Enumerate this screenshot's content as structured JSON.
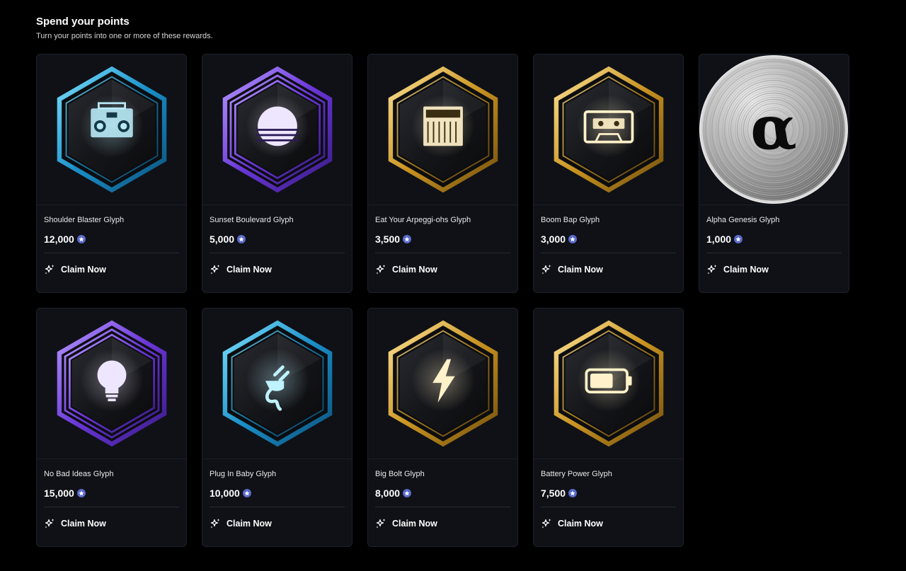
{
  "header": {
    "title": "Spend your points",
    "subtitle": "Turn your points into one or more of these rewards."
  },
  "icons": {
    "points": "star-icon",
    "claim": "sparkles-icon"
  },
  "colors": {
    "background": "#000000",
    "card": "#0f1117",
    "point_badge": "#5a6ac9",
    "blue_frame": "#2fb4e8",
    "purple_frame": "#7a4de0",
    "gold_frame": "#d7a93a"
  },
  "rewards": [
    {
      "name": "Shoulder Blaster Glyph",
      "price": "12,000",
      "claim_label": "Claim Now",
      "frame": "blue",
      "glyph": "boombox"
    },
    {
      "name": "Sunset Boulevard Glyph",
      "price": "5,000",
      "claim_label": "Claim Now",
      "frame": "purple",
      "glyph": "sun"
    },
    {
      "name": "Eat Your Arpeggi-ohs Glyph",
      "price": "3,500",
      "claim_label": "Claim Now",
      "frame": "gold",
      "glyph": "synth"
    },
    {
      "name": "Boom Bap Glyph",
      "price": "3,000",
      "claim_label": "Claim Now",
      "frame": "gold",
      "glyph": "cassette"
    },
    {
      "name": "Alpha Genesis Glyph",
      "price": "1,000",
      "claim_label": "Claim Now",
      "frame": "coin",
      "glyph": "alpha",
      "glyph_text": "α"
    },
    {
      "name": "No Bad Ideas Glyph",
      "price": "15,000",
      "claim_label": "Claim Now",
      "frame": "purple",
      "glyph": "lightbulb"
    },
    {
      "name": "Plug In Baby Glyph",
      "price": "10,000",
      "claim_label": "Claim Now",
      "frame": "blue",
      "glyph": "plug"
    },
    {
      "name": "Big Bolt Glyph",
      "price": "8,000",
      "claim_label": "Claim Now",
      "frame": "gold",
      "glyph": "bolt"
    },
    {
      "name": "Battery Power Glyph",
      "price": "7,500",
      "claim_label": "Claim Now",
      "frame": "gold",
      "glyph": "battery"
    }
  ]
}
